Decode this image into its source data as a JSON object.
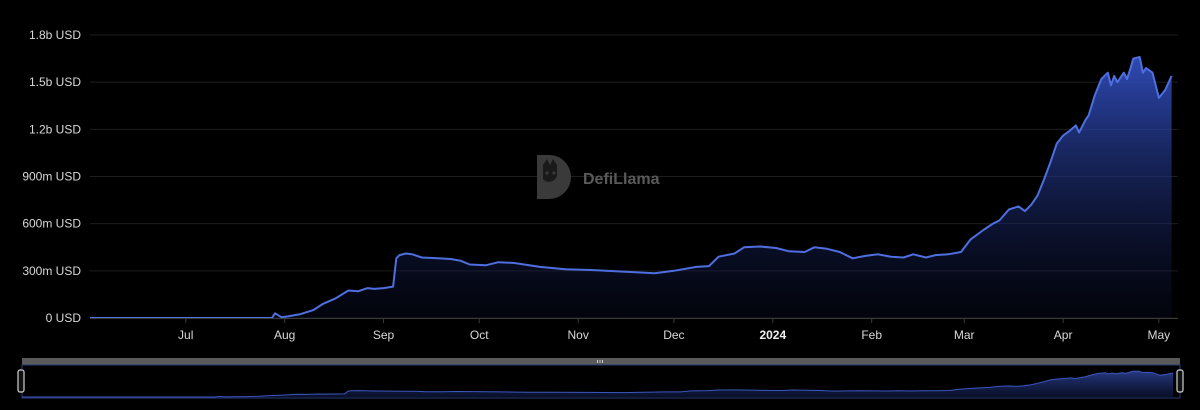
{
  "watermark": {
    "text": "DefiLlama"
  },
  "chart_data": {
    "type": "area",
    "ylabel": "",
    "xlabel": "",
    "ylim": [
      0,
      1800
    ],
    "y_ticks": [
      {
        "value": 0,
        "label": "0 USD"
      },
      {
        "value": 300,
        "label": "300m USD"
      },
      {
        "value": 600,
        "label": "600m USD"
      },
      {
        "value": 900,
        "label": "900m USD"
      },
      {
        "value": 1200,
        "label": "1.2b USD"
      },
      {
        "value": 1500,
        "label": "1.5b USD"
      },
      {
        "value": 1800,
        "label": "1.8b USD"
      }
    ],
    "xlim": [
      "2023-06-01",
      "2024-05-07"
    ],
    "x_ticks": [
      {
        "date": "2023-07-01",
        "label": "Jul",
        "bold": false
      },
      {
        "date": "2023-08-01",
        "label": "Aug",
        "bold": false
      },
      {
        "date": "2023-09-01",
        "label": "Sep",
        "bold": false
      },
      {
        "date": "2023-10-01",
        "label": "Oct",
        "bold": false
      },
      {
        "date": "2023-11-01",
        "label": "Nov",
        "bold": false
      },
      {
        "date": "2023-12-01",
        "label": "Dec",
        "bold": false
      },
      {
        "date": "2024-01-01",
        "label": "2024",
        "bold": true
      },
      {
        "date": "2024-02-01",
        "label": "Feb",
        "bold": false
      },
      {
        "date": "2024-03-01",
        "label": "Mar",
        "bold": false
      },
      {
        "date": "2024-04-01",
        "label": "Apr",
        "bold": false
      },
      {
        "date": "2024-05-01",
        "label": "May",
        "bold": false
      }
    ],
    "grid": true,
    "series": [
      {
        "color": "#4f6fe0",
        "points": [
          [
            "2023-06-01",
            0
          ],
          [
            "2023-07-15",
            0
          ],
          [
            "2023-07-28",
            0
          ],
          [
            "2023-07-29",
            30
          ],
          [
            "2023-07-31",
            5
          ],
          [
            "2023-08-02",
            10
          ],
          [
            "2023-08-06",
            25
          ],
          [
            "2023-08-10",
            50
          ],
          [
            "2023-08-13",
            90
          ],
          [
            "2023-08-17",
            125
          ],
          [
            "2023-08-21",
            175
          ],
          [
            "2023-08-24",
            170
          ],
          [
            "2023-08-27",
            190
          ],
          [
            "2023-08-29",
            185
          ],
          [
            "2023-09-01",
            190
          ],
          [
            "2023-09-04",
            200
          ],
          [
            "2023-09-05",
            380
          ],
          [
            "2023-09-06",
            400
          ],
          [
            "2023-09-08",
            410
          ],
          [
            "2023-09-10",
            405
          ],
          [
            "2023-09-13",
            385
          ],
          [
            "2023-09-18",
            380
          ],
          [
            "2023-09-22",
            375
          ],
          [
            "2023-09-25",
            365
          ],
          [
            "2023-09-28",
            340
          ],
          [
            "2023-10-03",
            335
          ],
          [
            "2023-10-07",
            355
          ],
          [
            "2023-10-12",
            350
          ],
          [
            "2023-10-20",
            325
          ],
          [
            "2023-10-28",
            310
          ],
          [
            "2023-11-05",
            305
          ],
          [
            "2023-11-15",
            295
          ],
          [
            "2023-11-25",
            285
          ],
          [
            "2023-12-01",
            300
          ],
          [
            "2023-12-08",
            325
          ],
          [
            "2023-12-12",
            330
          ],
          [
            "2023-12-15",
            390
          ],
          [
            "2023-12-20",
            410
          ],
          [
            "2023-12-23",
            450
          ],
          [
            "2023-12-28",
            455
          ],
          [
            "2024-01-02",
            445
          ],
          [
            "2024-01-06",
            425
          ],
          [
            "2024-01-11",
            420
          ],
          [
            "2024-01-14",
            450
          ],
          [
            "2024-01-18",
            440
          ],
          [
            "2024-01-22",
            420
          ],
          [
            "2024-01-26",
            380
          ],
          [
            "2024-01-30",
            395
          ],
          [
            "2024-02-03",
            405
          ],
          [
            "2024-02-07",
            390
          ],
          [
            "2024-02-11",
            385
          ],
          [
            "2024-02-14",
            405
          ],
          [
            "2024-02-18",
            385
          ],
          [
            "2024-02-21",
            400
          ],
          [
            "2024-02-25",
            405
          ],
          [
            "2024-02-29",
            420
          ],
          [
            "2024-03-03",
            500
          ],
          [
            "2024-03-07",
            560
          ],
          [
            "2024-03-10",
            600
          ],
          [
            "2024-03-12",
            620
          ],
          [
            "2024-03-15",
            690
          ],
          [
            "2024-03-18",
            710
          ],
          [
            "2024-03-20",
            680
          ],
          [
            "2024-03-22",
            720
          ],
          [
            "2024-03-24",
            780
          ],
          [
            "2024-03-26",
            880
          ],
          [
            "2024-03-28",
            990
          ],
          [
            "2024-03-30",
            1110
          ],
          [
            "2024-04-01",
            1160
          ],
          [
            "2024-04-03",
            1190
          ],
          [
            "2024-04-05",
            1225
          ],
          [
            "2024-04-06",
            1180
          ],
          [
            "2024-04-08",
            1260
          ],
          [
            "2024-04-09",
            1290
          ],
          [
            "2024-04-11",
            1420
          ],
          [
            "2024-04-13",
            1520
          ],
          [
            "2024-04-15",
            1560
          ],
          [
            "2024-04-16",
            1480
          ],
          [
            "2024-04-17",
            1540
          ],
          [
            "2024-04-18",
            1500
          ],
          [
            "2024-04-20",
            1560
          ],
          [
            "2024-04-21",
            1520
          ],
          [
            "2024-04-22",
            1580
          ],
          [
            "2024-04-23",
            1650
          ],
          [
            "2024-04-25",
            1660
          ],
          [
            "2024-04-26",
            1560
          ],
          [
            "2024-04-27",
            1590
          ],
          [
            "2024-04-29",
            1560
          ],
          [
            "2024-05-01",
            1400
          ],
          [
            "2024-05-03",
            1450
          ],
          [
            "2024-05-05",
            1540
          ]
        ]
      }
    ]
  }
}
